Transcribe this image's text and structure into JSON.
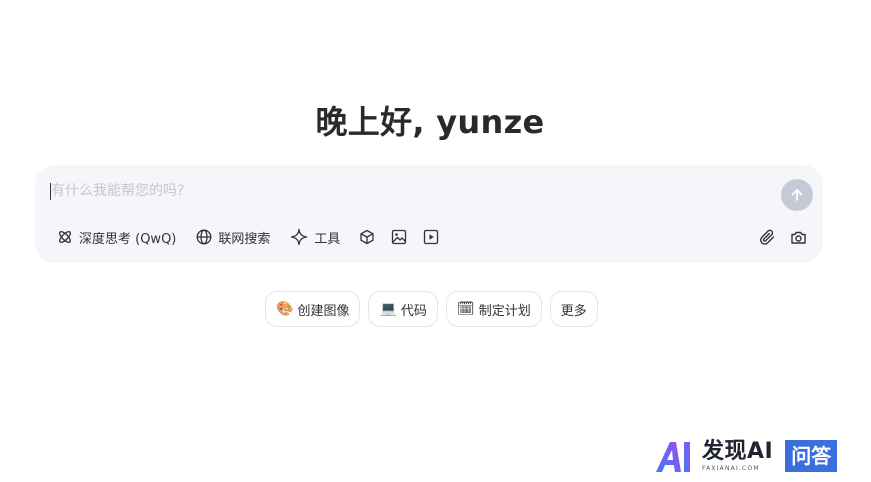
{
  "greeting": "晚上好, yunze",
  "composer": {
    "placeholder": "有什么我能帮您的吗?",
    "value": ""
  },
  "toolbar": {
    "deep_think": {
      "label": "深度思考 (QwQ)",
      "icon": "atom-icon"
    },
    "web_search": {
      "label": "联网搜索",
      "icon": "globe-icon"
    },
    "tools": {
      "label": "工具",
      "icon": "sparkle-icon"
    },
    "cube": {
      "icon": "cube-icon"
    },
    "image": {
      "icon": "image-icon"
    },
    "video": {
      "icon": "video-icon"
    },
    "attach": {
      "icon": "paperclip-icon"
    },
    "camera": {
      "icon": "camera-icon"
    },
    "send": {
      "icon": "arrow-up-icon"
    }
  },
  "chips": [
    {
      "emoji": "🎨",
      "label": "创建图像"
    },
    {
      "emoji": "💻",
      "label": "代码"
    },
    {
      "emoji": "🗓",
      "label": "制定计划"
    },
    {
      "emoji": "",
      "label": "更多"
    }
  ],
  "watermark": {
    "brand": "发现AI",
    "sub": "FAXIANAI.COM",
    "badge": "问答"
  },
  "colors": {
    "composer_bg": "#f5f6fa",
    "send_disabled": "#c7c9d6",
    "placeholder": "#c4c7d2",
    "badge_blue": "#3c6fde"
  }
}
